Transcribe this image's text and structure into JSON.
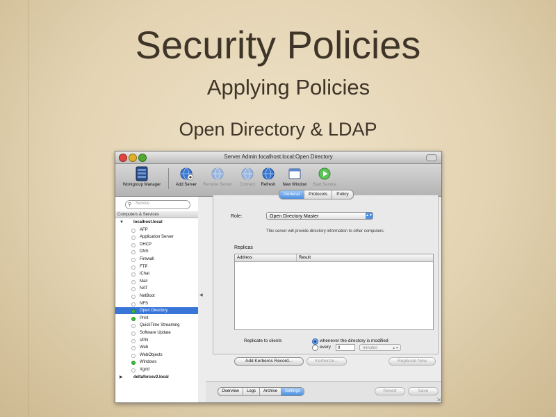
{
  "slide": {
    "title": "Security Policies",
    "subtitle": "Applying Policies",
    "subtitle2": "Open Directory & LDAP"
  },
  "window": {
    "title": "Server Admin:localhost.local:Open Directory"
  },
  "toolbar": {
    "workgroup_manager": "Workgroup Manager",
    "add_server": "Add Server",
    "remove_server": "Remove Server",
    "connect": "Connect",
    "refresh": "Refresh",
    "new_window": "New Window",
    "start_service": "Start Service"
  },
  "sidebar": {
    "search_placeholder": "Service",
    "header": "Computers & Services",
    "host1": "localhost.local",
    "services": [
      {
        "label": "AFP",
        "running": false
      },
      {
        "label": "Application Server",
        "running": false
      },
      {
        "label": "DHCP",
        "running": false
      },
      {
        "label": "DNS",
        "running": false
      },
      {
        "label": "Firewall",
        "running": false
      },
      {
        "label": "FTP",
        "running": false
      },
      {
        "label": "iChat",
        "running": false
      },
      {
        "label": "Mail",
        "running": false
      },
      {
        "label": "NAT",
        "running": false
      },
      {
        "label": "NetBoot",
        "running": false
      },
      {
        "label": "NFS",
        "running": false
      },
      {
        "label": "Open Directory",
        "running": true
      },
      {
        "label": "Print",
        "running": true
      },
      {
        "label": "QuickTime Streaming",
        "running": false
      },
      {
        "label": "Software Update",
        "running": false
      },
      {
        "label": "VPN",
        "running": false
      },
      {
        "label": "Web",
        "running": false
      },
      {
        "label": "WebObjects",
        "running": false
      },
      {
        "label": "Windows",
        "running": true
      },
      {
        "label": "Xgrid",
        "running": false
      }
    ],
    "selected_service": "Open Directory",
    "host2": "deltaforcev2.local"
  },
  "pane": {
    "tabs": [
      "General",
      "Protocols",
      "Policy"
    ],
    "active_tab": "General",
    "role_label": "Role:",
    "role_value": "Open Directory Master",
    "role_description": "This server will provide directory information to other computers.",
    "replicas_label": "Replicas",
    "replicas_columns": [
      "Address",
      "Result"
    ],
    "replicate_label": "Replicate to clients",
    "option_modified": "whenever the directory is modified",
    "option_every": "every",
    "every_value": "0",
    "every_unit": "minutes",
    "add_kerberos": "Add Kerberos Record...",
    "kerberize": "Kerberize...",
    "replicate_now": "Replicate Now"
  },
  "bottom": {
    "tabs": [
      "Overview",
      "Logs",
      "Archive",
      "Settings"
    ],
    "active_tab": "Settings",
    "revert": "Revert",
    "save": "Save"
  },
  "colors": {
    "background": "#e6d7b8",
    "slide_text": "#3e3528",
    "selection": "#3875d7",
    "active_tab": "#4d8fe0",
    "running_dot": "#3fbf3f"
  },
  "icons": {
    "workgroup_manager": "server-rack-icon",
    "add_server": "plus-globe-icon",
    "remove_server": "minus-globe-icon",
    "connect": "globe-icon",
    "refresh": "refresh-globe-icon",
    "new_window": "window-icon",
    "start_service": "play-icon"
  }
}
